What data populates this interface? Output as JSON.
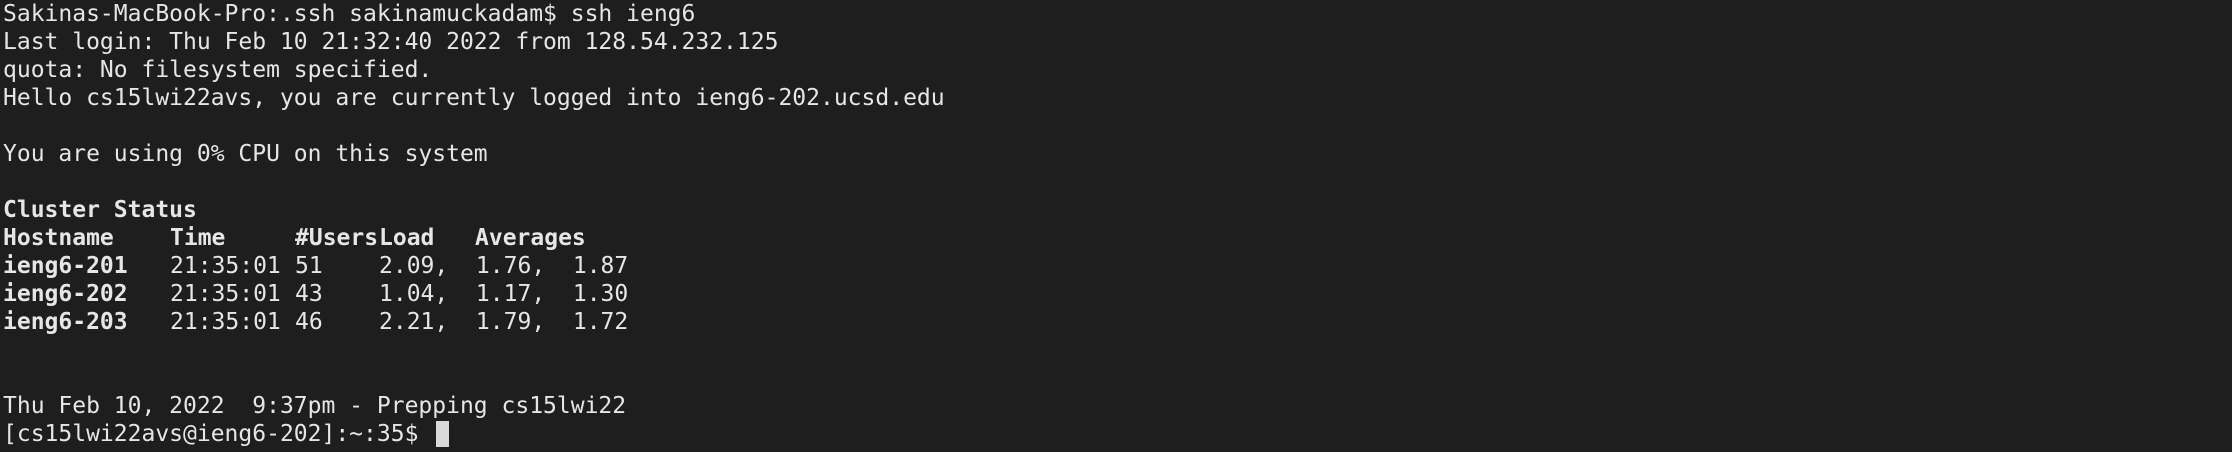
{
  "terminal": {
    "command_line": "Sakinas-MacBook-Pro:.ssh sakinamuckadam$ ssh ieng6",
    "last_login": "Last login: Thu Feb 10 21:32:40 2022 from 128.54.232.125",
    "quota": "quota: No filesystem specified.",
    "hello": "Hello cs15lwi22avs, you are currently logged into ieng6-202.ucsd.edu",
    "cpu": "You are using 0% CPU on this system",
    "cluster_title": "Cluster Status",
    "cluster_headers": {
      "hostname": "Hostname",
      "time": "Time",
      "users": "#Users",
      "load": "Load",
      "averages": "Averages"
    },
    "cluster_rows": [
      {
        "host": "ieng6-201",
        "time": "21:35:01",
        "users": "51",
        "loads": "2.09,  1.76,  1.87"
      },
      {
        "host": "ieng6-202",
        "time": "21:35:01",
        "users": "43",
        "loads": "1.04,  1.17,  1.30"
      },
      {
        "host": "ieng6-203",
        "time": "21:35:01",
        "users": "46",
        "loads": "2.21,  1.79,  1.72"
      }
    ],
    "status_line": "Thu Feb 10, 2022  9:37pm - Prepping cs15lwi22",
    "prompt": "[cs15lwi22avs@ieng6-202]:~:35$ "
  }
}
